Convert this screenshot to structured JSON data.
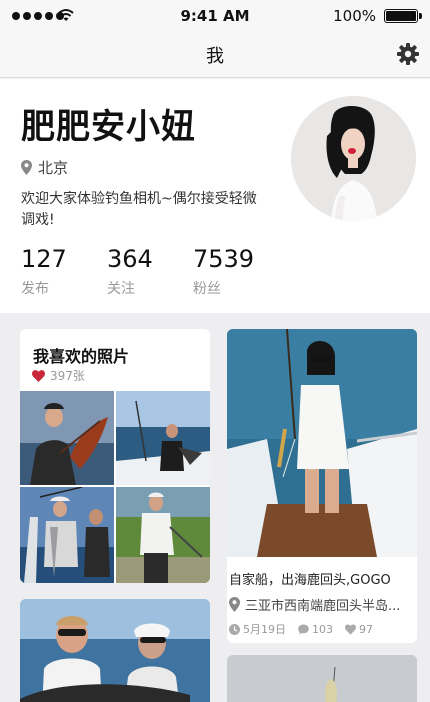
{
  "status_bar": {
    "time": "9:41 AM",
    "battery": "100%"
  },
  "nav": {
    "title": "我",
    "settings_icon": "gear-icon"
  },
  "profile": {
    "name": "肥肥安小妞",
    "location": "北京",
    "bio": "欢迎大家体验钓鱼相机~偶尔接受轻微调戏!",
    "stats": [
      {
        "value": "127",
        "label": "发布"
      },
      {
        "value": "364",
        "label": "关注"
      },
      {
        "value": "7539",
        "label": "粉丝"
      }
    ]
  },
  "album": {
    "title": "我喜欢的照片",
    "count": "397张",
    "heart_color": "#c8283a"
  },
  "photo_post": {
    "title": "自家船，出海鹿回头,GOGO",
    "location": "三亚市西南端鹿回头半岛...",
    "date": "5月19日",
    "comments": "103",
    "likes": "97"
  }
}
